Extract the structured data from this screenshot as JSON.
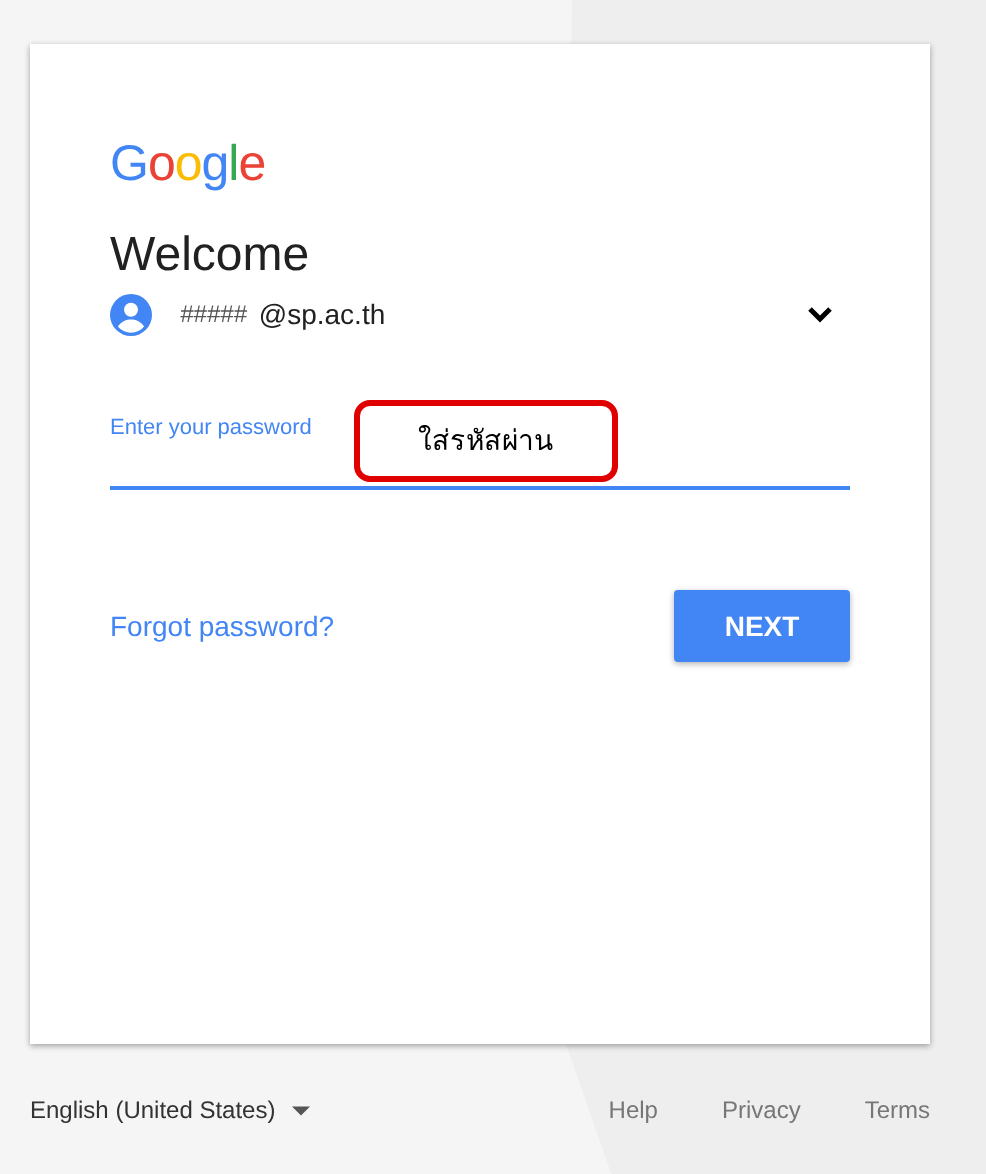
{
  "logo": "Google",
  "title": "Welcome",
  "account": {
    "name": "#####",
    "email": "@sp.ac.th"
  },
  "password_field": {
    "label": "Enter your password",
    "focused": true
  },
  "annotation": {
    "text": "ใส่รหัสผ่าน"
  },
  "forgot_link": "Forgot password?",
  "next_button": "NEXT",
  "footer": {
    "language": "English (United States)",
    "links": [
      "Help",
      "Privacy",
      "Terms"
    ]
  }
}
